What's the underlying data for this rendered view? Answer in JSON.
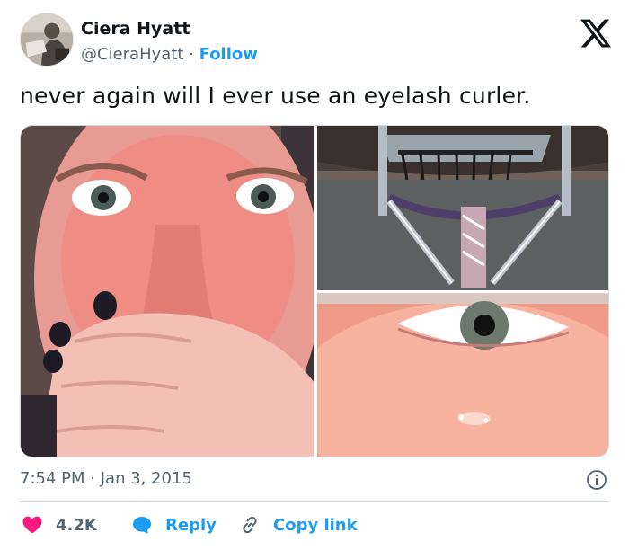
{
  "author": {
    "name": "Ciera Hyatt",
    "handle": "@CieraHyatt",
    "separator": "·",
    "follow_label": "Follow"
  },
  "brand_icon": "x-logo-icon",
  "tweet": {
    "text": "never again will I ever use an eyelash curler."
  },
  "media": {
    "count": 3,
    "items": [
      {
        "icon": "photo-face-crying"
      },
      {
        "icon": "photo-eyelash-curler"
      },
      {
        "icon": "photo-eye-closeup"
      }
    ]
  },
  "meta": {
    "time": "7:54 PM",
    "separator": "·",
    "date": "Jan 3, 2015",
    "info_icon": "info-icon"
  },
  "actions": {
    "like_count": "4.2K",
    "reply_label": "Reply",
    "copy_label": "Copy link"
  },
  "colors": {
    "accent": "#1d9bf0",
    "like": "#f91880",
    "text": "#0f1419",
    "muted": "#536471",
    "border": "#cfd9de"
  }
}
